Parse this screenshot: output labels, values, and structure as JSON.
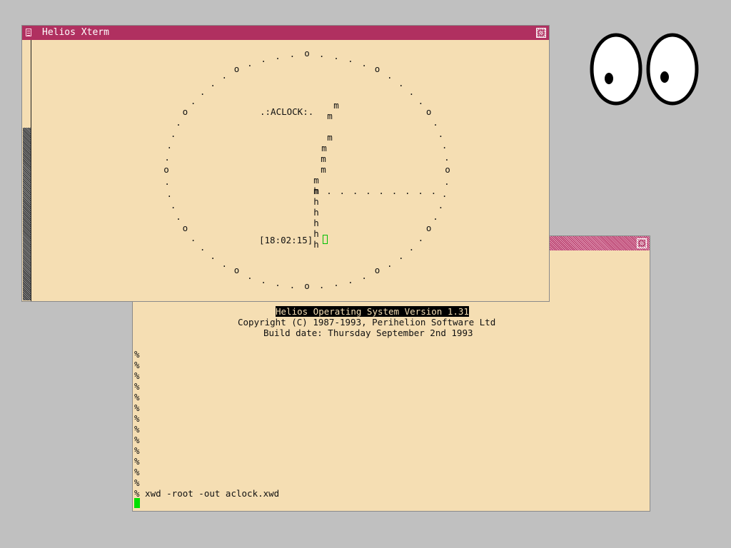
{
  "xterm_clock": {
    "title": "Helios Xterm",
    "icons": {
      "menu": "window-menu-icon",
      "close": "close-icon"
    },
    "clock_label": ".:ACLOCK:.",
    "clock_time": "[18:02:15]",
    "face_chars": {
      "hour_marker": "o",
      "minute_tick": ".",
      "hour_hand": "h",
      "minute_hand": "m",
      "second_hand": "."
    }
  },
  "xterm_console": {
    "icons": {
      "close": "close-icon"
    },
    "banner": [
      "Helios Operating System Version 1.31",
      "Copyright (C) 1987-1993, Perihelion Software Ltd",
      "Build date: Thursday September 2nd 1993"
    ],
    "prompt_lines": [
      "%",
      "%",
      "%",
      "%",
      "%",
      "%",
      "%",
      "%",
      "%",
      "%",
      "%",
      "%",
      "%"
    ],
    "last_command": "% xwd -root -out aclock.xwd"
  },
  "xeyes": {
    "icon": "xeyes-icon"
  },
  "colors": {
    "desktop": "#c0c0c0",
    "terminal_bg": "#f5deb3",
    "titlebar": "#b03060",
    "cursor": "#00e000"
  }
}
